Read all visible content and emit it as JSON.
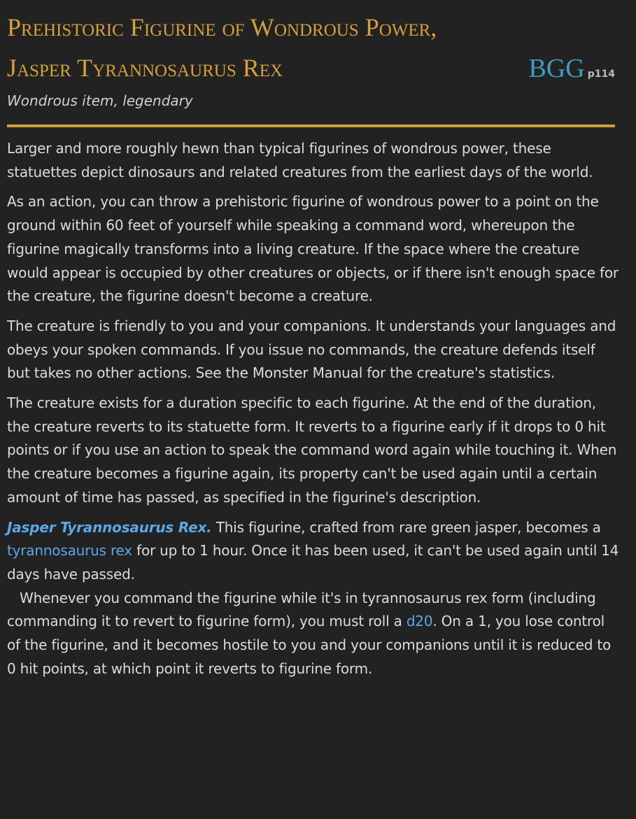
{
  "header": {
    "title": "Prehistoric Figurine of Wondrous Power, Jasper Tyrannosaurus Rex",
    "source": "BGG",
    "page": "p114",
    "subtitle": "Wondrous item, legendary"
  },
  "body": {
    "p1": "Larger and more roughly hewn than typical figurines of wondrous power, these statuettes depict dinosaurs and related creatures from the earliest days of the world.",
    "p2": "As an action, you can throw a prehistoric figurine of wondrous power to a point on the ground within 60 feet of yourself while speaking a command word, whereupon the figurine magically transforms into a living creature. If the space where the creature would appear is occupied by other creatures or objects, or if there isn't enough space for the creature, the figurine doesn't become a creature.",
    "p3": "The creature is friendly to you and your companions. It understands your languages and obeys your spoken commands. If you issue no commands, the creature defends itself but takes no other actions. See the Monster Manual for the creature's statistics.",
    "p4": "The creature exists for a duration specific to each figurine. At the end of the duration, the creature reverts to its statuette form. It reverts to a figurine early if it drops to 0 hit points or if you use an action to speak the command word again while touching it. When the creature becomes a figurine again, its property can't be used again until a certain amount of time has passed, as specified in the figurine's description.",
    "p5_heading": "Jasper Tyrannosaurus Rex.",
    "p5_a": " This figurine, crafted from rare green jasper, becomes a ",
    "p5_link": "tyrannosaurus rex",
    "p5_b": " for up to 1 hour. Once it has been used, it can't be used again until 14 days have passed.",
    "p6_a": "Whenever you command the figurine while it's in tyrannosaurus rex form (including commanding it to revert to figurine form), you must roll a ",
    "p6_link": "d20",
    "p6_b": ". On a 1, you lose control of the figurine, and it becomes hostile to you and your companions until it is reduced to 0 hit points, at which point it reverts to figurine form."
  }
}
